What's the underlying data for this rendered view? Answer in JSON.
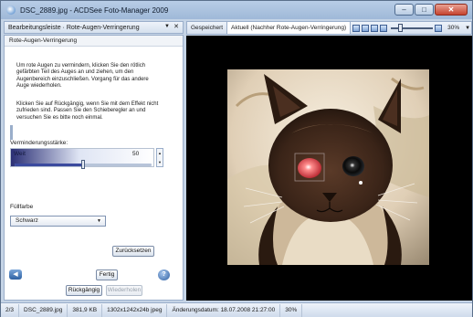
{
  "window": {
    "title": "DSC_2889.jpg - ACDSee Foto-Manager 2009",
    "controls": {
      "minimize": "–",
      "maximize": "□",
      "close": "✕"
    }
  },
  "left_header": {
    "label": "Bearbeitungsleiste · Rote-Augen-Verringerung",
    "dropdown": "▼",
    "close": "✕"
  },
  "panel": {
    "title": "Rote-Augen-Verringerung",
    "para1": "Um rote Augen zu vermindern, klicken Sie den rötlich gefärbten Teil des Auges an und ziehen, um den Augenbereich einzuschließen. Vorgang für das andere Auge wiederholen.",
    "para2": "Klicken Sie auf Rückgängig, wenn Sie mit dem Effekt nicht zufrieden sind. Passen Sie den Schieberegler an und versuchen Sie es bitte noch einmal.",
    "strength_label": "Verminderungsstärke:",
    "strength_name": "Weit",
    "strength_value": "50",
    "strength_fraction": 0.5,
    "spin_up": "▲",
    "spin_down": "▼",
    "fill_label": "Füllfarbe",
    "fill_value": "Schwarz",
    "fill_arrow": "▼",
    "reset_button": "Zurücksetzen"
  },
  "bottom": {
    "nav_left": "◀",
    "help": "?",
    "done_button": "Fertig",
    "undo_button": "Rückgängig",
    "redo_button": "Wiederholen"
  },
  "toolbar": {
    "tab_saved": "Gespeichert",
    "tab_current": "Aktuell (Nachher Rote-Augen-Verringerung)",
    "zoom_value": "30%",
    "menu": "▼"
  },
  "status": {
    "position": "2/3",
    "filename": "DSC_2889.jpg",
    "size": "381,9 KB",
    "dimensions": "1302x1242x24b jpeg",
    "modified": "Änderungsdatum: 18.07.2008 21:27:00",
    "zoom": "30%"
  },
  "colors": {
    "frame": "#c5d4e6",
    "slider_fill": "#3b4a9e",
    "viewer_bg": "#000000"
  }
}
